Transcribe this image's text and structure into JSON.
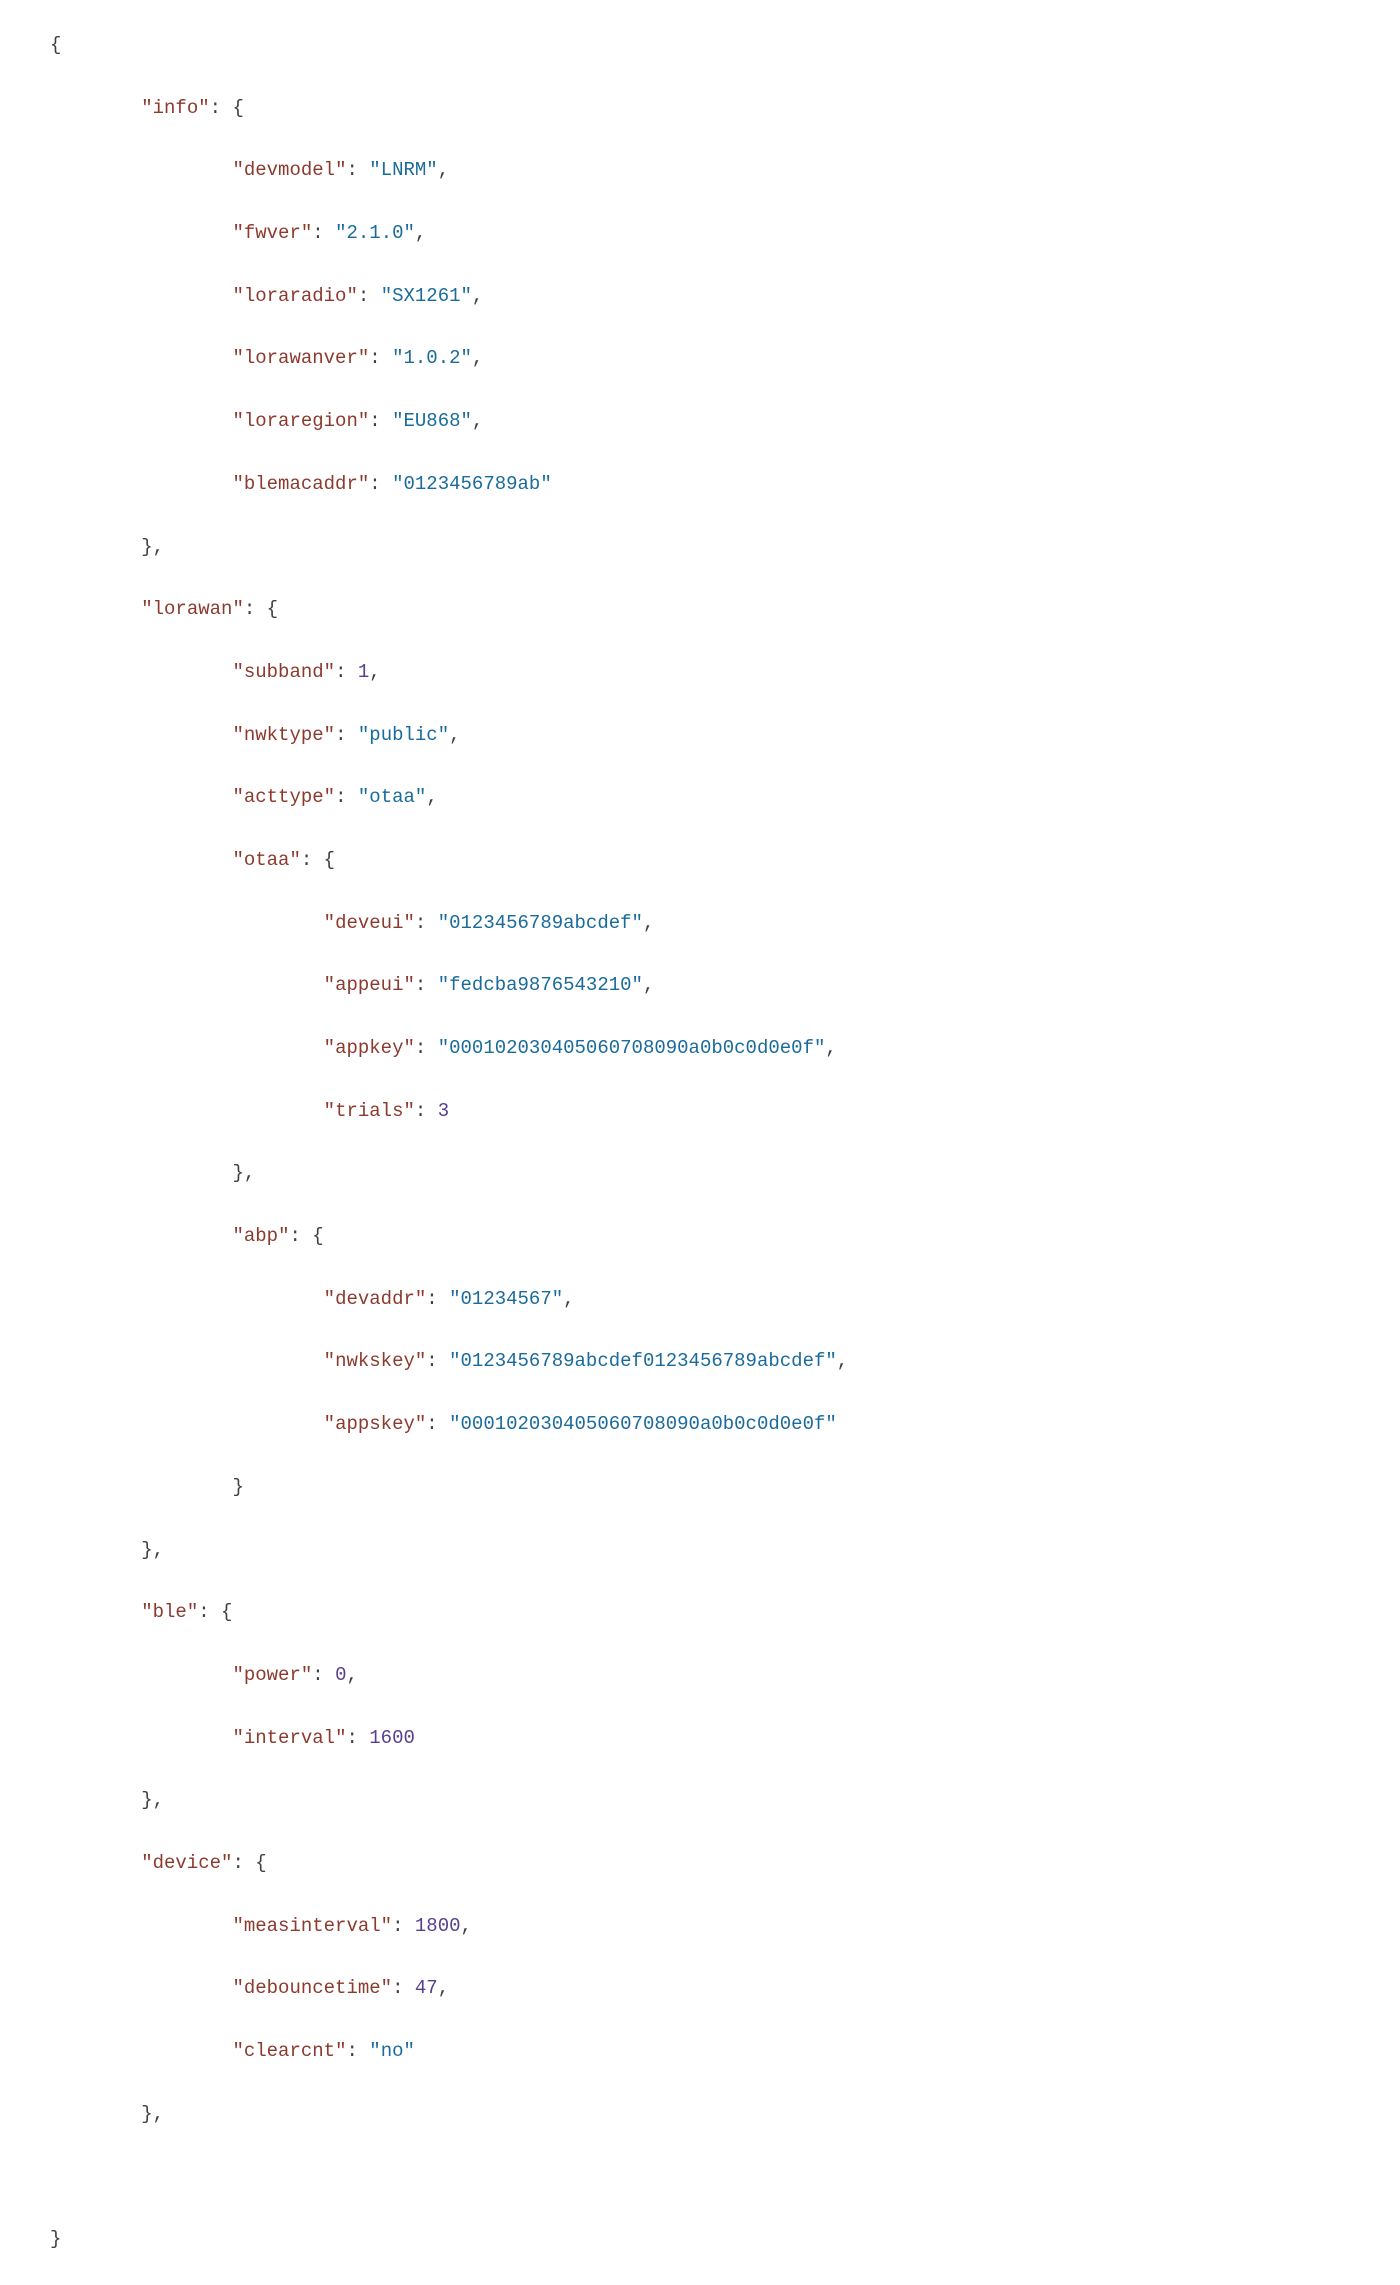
{
  "keys": {
    "info": "info",
    "devmodel": "devmodel",
    "fwver": "fwver",
    "loraradio": "loraradio",
    "lorawanver": "lorawanver",
    "loraregion": "loraregion",
    "blemacaddr": "blemacaddr",
    "lorawan": "lorawan",
    "subband": "subband",
    "nwktype": "nwktype",
    "acttype": "acttype",
    "otaa": "otaa",
    "deveui": "deveui",
    "appeui": "appeui",
    "appkey": "appkey",
    "trials": "trials",
    "abp": "abp",
    "devaddr": "devaddr",
    "nwkskey": "nwkskey",
    "appskey": "appskey",
    "ble": "ble",
    "power": "power",
    "interval": "interval",
    "device": "device",
    "measinterval": "measinterval",
    "debouncetime": "debouncetime",
    "clearcnt": "clearcnt"
  },
  "values": {
    "devmodel": "LNRM",
    "fwver": "2.1.0",
    "loraradio": "SX1261",
    "lorawanver": "1.0.2",
    "loraregion": "EU868",
    "blemacaddr": "0123456789ab",
    "subband": "1",
    "nwktype": "public",
    "acttype": "otaa",
    "deveui": "0123456789abcdef",
    "appeui": "fedcba9876543210",
    "appkey": "000102030405060708090a0b0c0d0e0f",
    "trials": "3",
    "devaddr": "01234567",
    "nwkskey": "0123456789abcdef0123456789abcdef",
    "appskey": "000102030405060708090a0b0c0d0e0f",
    "power": "0",
    "interval": "1600",
    "measinterval": "1800",
    "debouncetime": "47",
    "clearcnt": "no"
  }
}
